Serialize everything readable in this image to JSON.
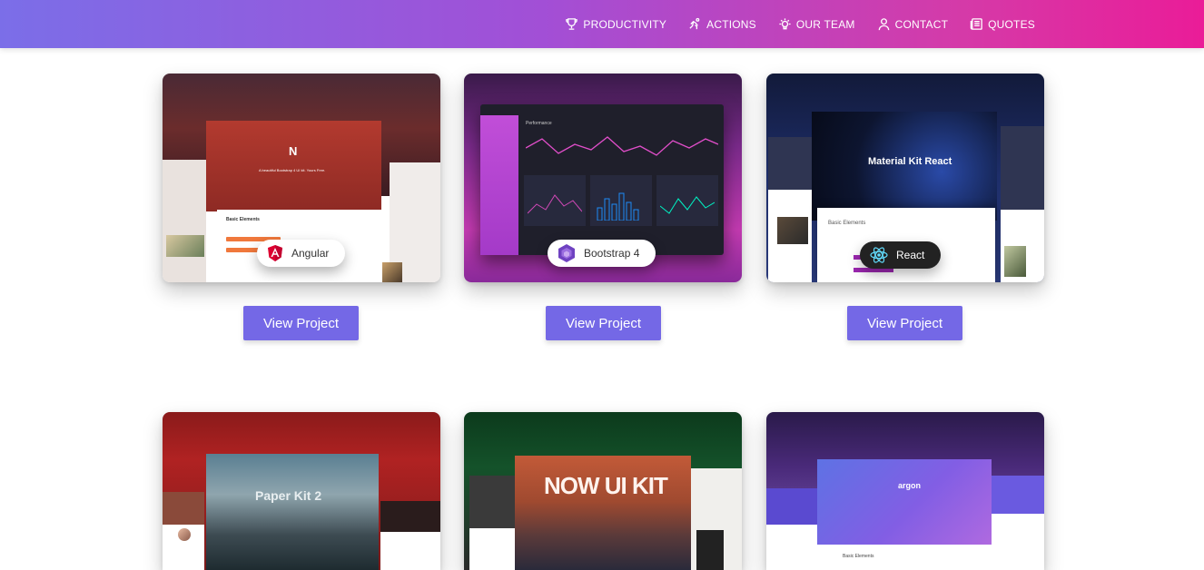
{
  "nav": {
    "items": [
      {
        "label": "PRODUCTIVITY",
        "icon": "trophy-icon"
      },
      {
        "label": "ACTIONS",
        "icon": "running-icon"
      },
      {
        "label": "OUR TEAM",
        "icon": "lightbulb-icon"
      },
      {
        "label": "CONTACT",
        "icon": "user-icon"
      },
      {
        "label": "QUOTES",
        "icon": "newspaper-icon"
      }
    ]
  },
  "projects": [
    {
      "badge": "Angular",
      "button": "View Project",
      "preview_title": "N",
      "preview_sub": "A beautiful Bootstrap 4 UI kit. Yours Free.",
      "preview_section": "Basic Elements"
    },
    {
      "badge": "Bootstrap 4",
      "button": "View Project",
      "preview_title": "Performance"
    },
    {
      "badge": "React",
      "button": "View Project",
      "preview_title": "Material Kit React",
      "preview_sub": "Basic Elements"
    },
    {
      "preview_title": "Paper Kit 2"
    },
    {
      "preview_title": "NOW UI KIT"
    },
    {
      "preview_title": "argon",
      "preview_sub": "Basic Elements"
    }
  ],
  "colors": {
    "header_start": "#7b6ee8",
    "header_end": "#ea1c98",
    "button": "#7468e6"
  }
}
